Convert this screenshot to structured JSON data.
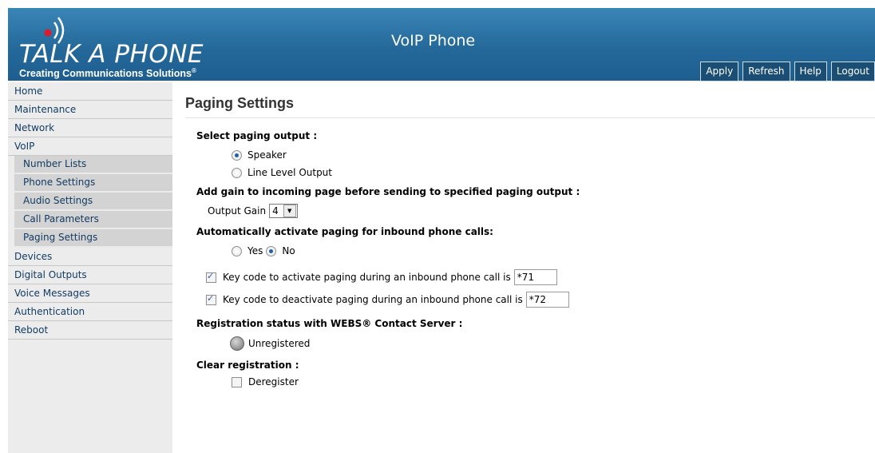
{
  "brand": {
    "logo_title": "TALK A PHONE",
    "tagline": "Creating Communications Solutions",
    "tagline_mark": "®"
  },
  "app_title": "VoIP Phone",
  "toolbar": [
    "Apply",
    "Refresh",
    "Help",
    "Logout"
  ],
  "sidebar": {
    "home": "Home",
    "maintenance": "Maintenance",
    "network": "Network",
    "voip": "VoIP",
    "voip_sub": [
      "Number Lists",
      "Phone Settings",
      "Audio Settings",
      "Call Parameters",
      "Paging Settings"
    ],
    "devices": "Devices",
    "digital_outputs": "Digital Outputs",
    "voice_messages": "Voice Messages",
    "authentication": "Authentication",
    "reboot": "Reboot"
  },
  "page_title": "Paging Settings",
  "paging_output": {
    "label": "Select paging output :",
    "options": [
      {
        "label": "Speaker",
        "selected": true
      },
      {
        "label": "Line Level Output",
        "selected": false
      }
    ]
  },
  "gain": {
    "label": "Add gain to incoming page before sending to specified paging output :",
    "field_label": "Output Gain",
    "value": "4"
  },
  "auto_activate": {
    "label": "Automatically activate paging for inbound phone calls:",
    "yes": "Yes",
    "no": "No",
    "selected": "No"
  },
  "key_activate": {
    "checked": true,
    "label": "Key code to activate paging during an inbound phone call is",
    "value": "*71"
  },
  "key_deactivate": {
    "checked": true,
    "label": "Key code to deactivate paging during an inbound phone call is",
    "value": "*72"
  },
  "registration": {
    "label": "Registration status with WEBS® Contact Server :",
    "status": "Unregistered"
  },
  "clear_registration": {
    "label": "Clear registration :",
    "option": "Deregister",
    "checked": false
  },
  "colors": {
    "header": "#2a74a6",
    "sidebar": "#ececec",
    "nav_text": "#123c63",
    "button": "#1b4e75"
  }
}
